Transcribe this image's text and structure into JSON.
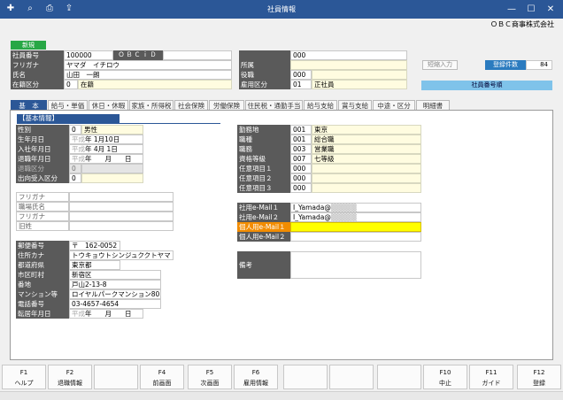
{
  "window": {
    "title": "社員情報",
    "company": "ＯＢＣ商事株式会社",
    "toolbar_icons": [
      "new-icon",
      "search-icon",
      "print-icon",
      "export-icon"
    ]
  },
  "header": {
    "new_badge": "新規",
    "emp_no_label": "社員番号",
    "emp_no": "100000",
    "obcid_label": "ＯＢＣｉＤ",
    "kana_label": "フリガナ",
    "kana": "ヤマダ　イチロウ",
    "name_label": "氏名",
    "name": "山田　一朗",
    "status_label": "在籍区分",
    "status_code": "0",
    "status_text": "在籍",
    "dept_label": "所属",
    "dept": "000",
    "post_label": "役職",
    "post": "000",
    "emptype_label": "雇用区分",
    "emptype_code": "01",
    "emptype_text": "正社員",
    "kana_input_button": "短縮入力",
    "reg_count_label": "登録件数",
    "reg_count": "84",
    "sort_label": "社員番号順"
  },
  "tabs": [
    "基　本",
    "給与・単価",
    "休日・休暇",
    "家族・所得税",
    "社会保険",
    "労働保険",
    "住民税・通勤手当",
    "給与支給",
    "賞与支給",
    "中途・区分",
    "明細書"
  ],
  "basic": {
    "section": "【基本情報】",
    "gender_label": "性別",
    "gender_code": "0",
    "gender_text": "男性",
    "birth_label": "生年月日",
    "birth_era": "平成",
    "birth_y": "年",
    "birth_md": "1月10日",
    "join_label": "入社年月日",
    "join_era": "平成",
    "join_y": "年",
    "join_md": "4月 1日",
    "retire_label": "退職年月日",
    "retire_era": "平成",
    "retire_ymd": "年　　月　　日",
    "retire_type_label": "退職区分",
    "retire_type": "0",
    "secondment_label": "出向受入区分",
    "secondment": "0",
    "kana2_label": "フリガナ",
    "old_name_label": "職場氏名",
    "kana3_label": "フリガナ",
    "former_label": "旧姓",
    "zip_label": "郵便番号",
    "zip": "〒　162-0052",
    "addr_kana_label": "住所カナ",
    "addr_kana": "トウキョウトシンジュククトヤマ",
    "pref_label": "都道府県",
    "pref": "東京都",
    "city_label": "市区町村",
    "city": "新宿区",
    "block_label": "番地",
    "block": "戸山2-13-8",
    "bldg_label": "マンション等",
    "bldg": "ロイヤルパークマンション805",
    "tel_label": "電話番号",
    "tel": "03-4657-4654",
    "move_label": "転居年月日",
    "move_era": "平成",
    "move_ymd": "年　　月　　日"
  },
  "work": {
    "location_label": "勤務地",
    "location_code": "001",
    "location": "東京",
    "job_label": "職種",
    "job_code": "001",
    "job": "総合職",
    "duty_label": "職務",
    "duty_code": "003",
    "duty": "営業職",
    "grade_label": "資格等級",
    "grade_code": "007",
    "grade": "七等級",
    "opt1_label": "任意項目１",
    "opt1": "000",
    "opt2_label": "任意項目２",
    "opt2": "000",
    "opt3_label": "任意項目３",
    "opt3": "000",
    "mail1_label": "社用e-Mail１",
    "mail1": "I_Yamada@",
    "mail2_label": "社用e-Mail２",
    "mail2": "I_Yamada@",
    "pmail1_label": "個人用e-Mail１",
    "pmail2_label": "個人用e-Mail２",
    "note_label": "備考"
  },
  "fkeys": [
    {
      "key": "F1",
      "label": "ヘルプ"
    },
    {
      "key": "F2",
      "label": "退職情報"
    },
    {
      "key": "",
      "label": ""
    },
    {
      "key": "F4",
      "label": "前画面"
    },
    {
      "key": "F5",
      "label": "次画面"
    },
    {
      "key": "F6",
      "label": "雇用情報"
    },
    {
      "key": "",
      "label": ""
    },
    {
      "key": "",
      "label": ""
    },
    {
      "key": "",
      "label": ""
    },
    {
      "key": "F10",
      "label": "中止"
    },
    {
      "key": "F11",
      "label": "ガイド"
    },
    {
      "key": "F12",
      "label": "登録"
    }
  ]
}
